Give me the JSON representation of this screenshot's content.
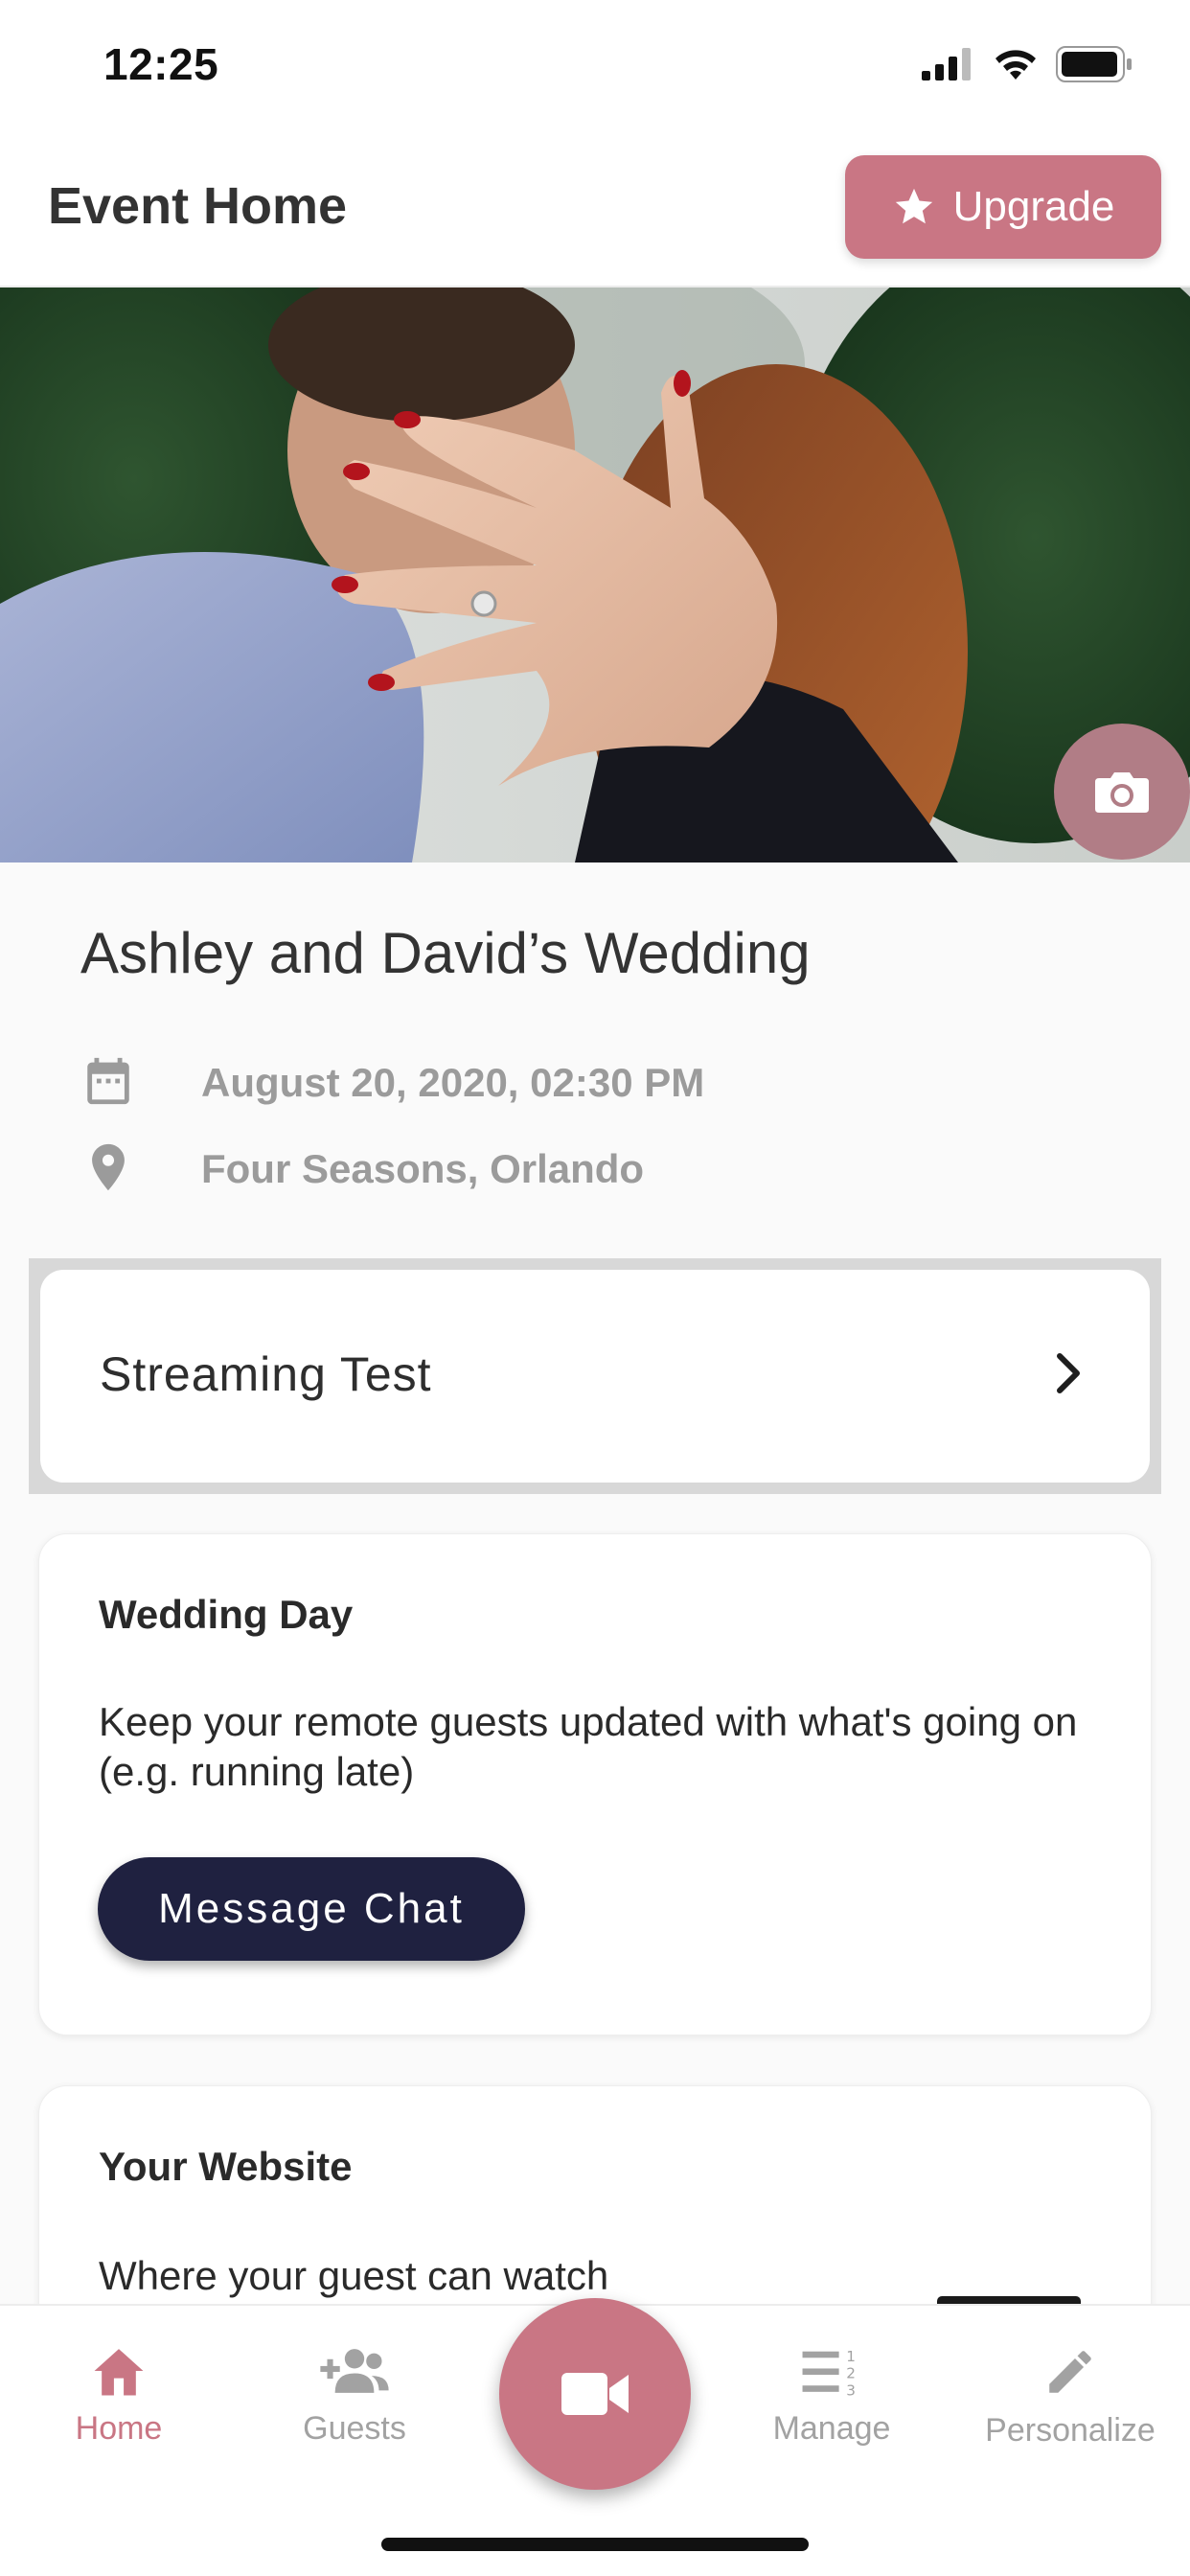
{
  "status_bar": {
    "time": "12:25"
  },
  "header": {
    "title": "Event Home",
    "upgrade_label": "Upgrade"
  },
  "event": {
    "title": "Ashley and David’s Wedding",
    "date": "August 20, 2020, 02:30 PM",
    "location": "Four Seasons, Orlando"
  },
  "streaming": {
    "label": "Streaming Test"
  },
  "wedding_day": {
    "title": "Wedding Day",
    "description": "Keep your remote guests updated with what's going on (e.g. running late)",
    "button_label": "Message Chat"
  },
  "website": {
    "title": "Your Website",
    "description": "Where your guest can watch"
  },
  "tabs": {
    "home": "Home",
    "guests": "Guests",
    "manage": "Manage",
    "personalize": "Personalize"
  },
  "colors": {
    "accent": "#c97684",
    "dark_button": "#1f2140",
    "muted_text": "#9b9b9b"
  }
}
